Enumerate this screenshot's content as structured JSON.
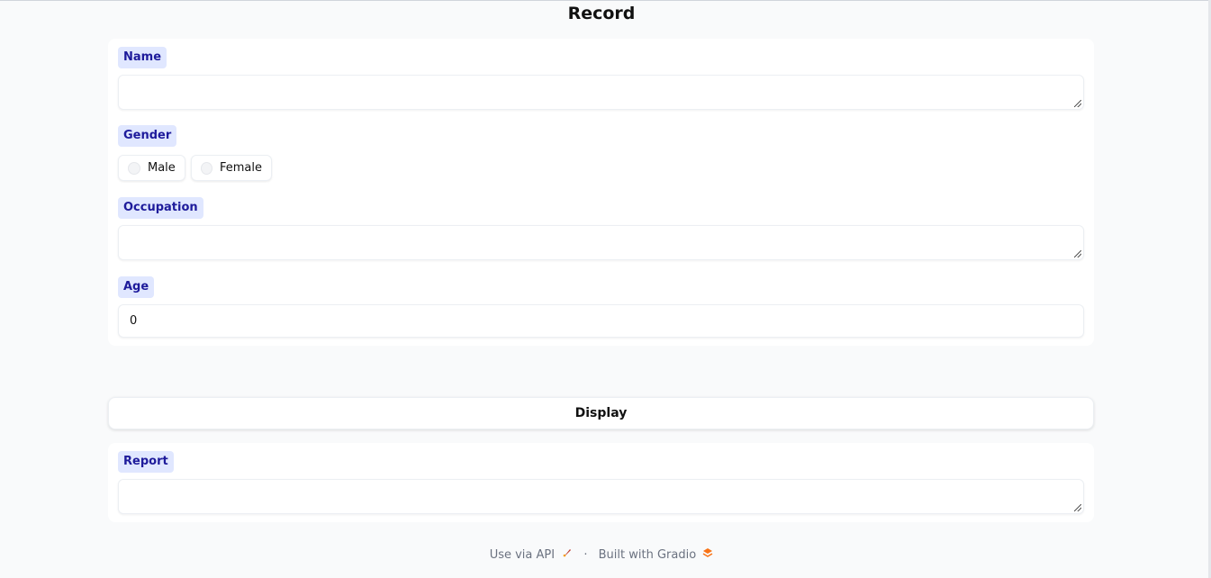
{
  "page": {
    "title": "Record"
  },
  "record": {
    "name_label": "Name",
    "name_value": "",
    "gender_label": "Gender",
    "gender_options": [
      "Male",
      "Female"
    ],
    "occupation_label": "Occupation",
    "occupation_value": "",
    "age_label": "Age",
    "age_value": "0"
  },
  "display_button": "Display",
  "report": {
    "label": "Report",
    "value": ""
  },
  "footer": {
    "api_link": "Use via API",
    "api_icon": "rocket-icon",
    "separator": "·",
    "built_with": "Built with Gradio",
    "gradio_icon": "gradio-logo-icon"
  },
  "colors": {
    "label_bg": "#e0e7ff",
    "label_text": "#1e1b9b"
  }
}
